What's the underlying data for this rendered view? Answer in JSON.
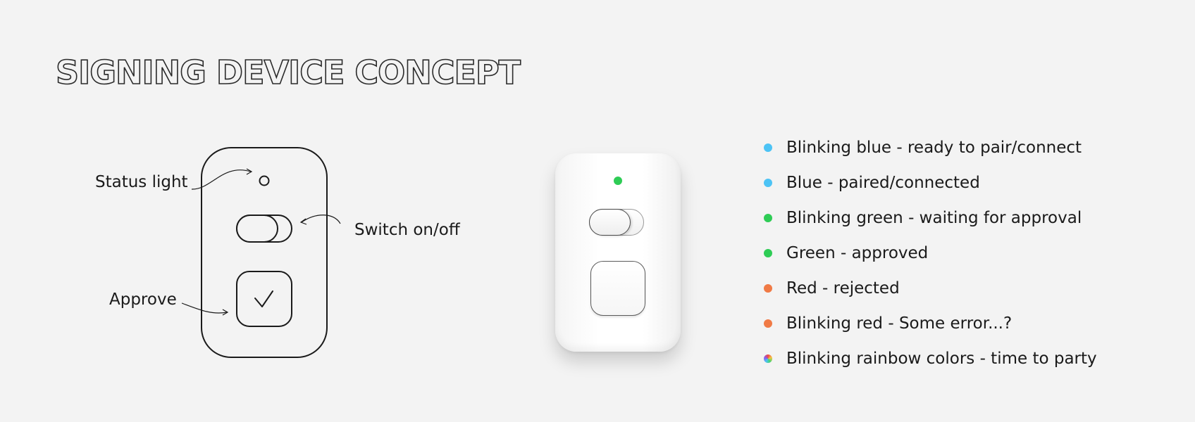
{
  "title": "SIGNING DEVICE CONCEPT",
  "diagram": {
    "labels": {
      "status_light": "Status light",
      "switch": "Switch on/off",
      "approve": "Approve"
    }
  },
  "device": {
    "led_color": "#2ecc55"
  },
  "legend": [
    {
      "text": "Blinking blue - ready to pair/connect",
      "color": "#4cc3f5",
      "icon": "status-dot"
    },
    {
      "text": "Blue - paired/connected",
      "color": "#4cc3f5",
      "icon": "status-dot"
    },
    {
      "text": "Blinking green - waiting for approval",
      "color": "#2ecc55",
      "icon": "status-dot"
    },
    {
      "text": "Green - approved",
      "color": "#2ecc55",
      "icon": "status-dot"
    },
    {
      "text": "Red - rejected",
      "color": "#f07a45",
      "icon": "status-dot"
    },
    {
      "text": "Blinking red - Some error...?",
      "color": "#f07a45",
      "icon": "status-dot"
    },
    {
      "text": "Blinking rainbow colors - time to party",
      "color": "rainbow",
      "icon": "rainbow-dot"
    }
  ]
}
